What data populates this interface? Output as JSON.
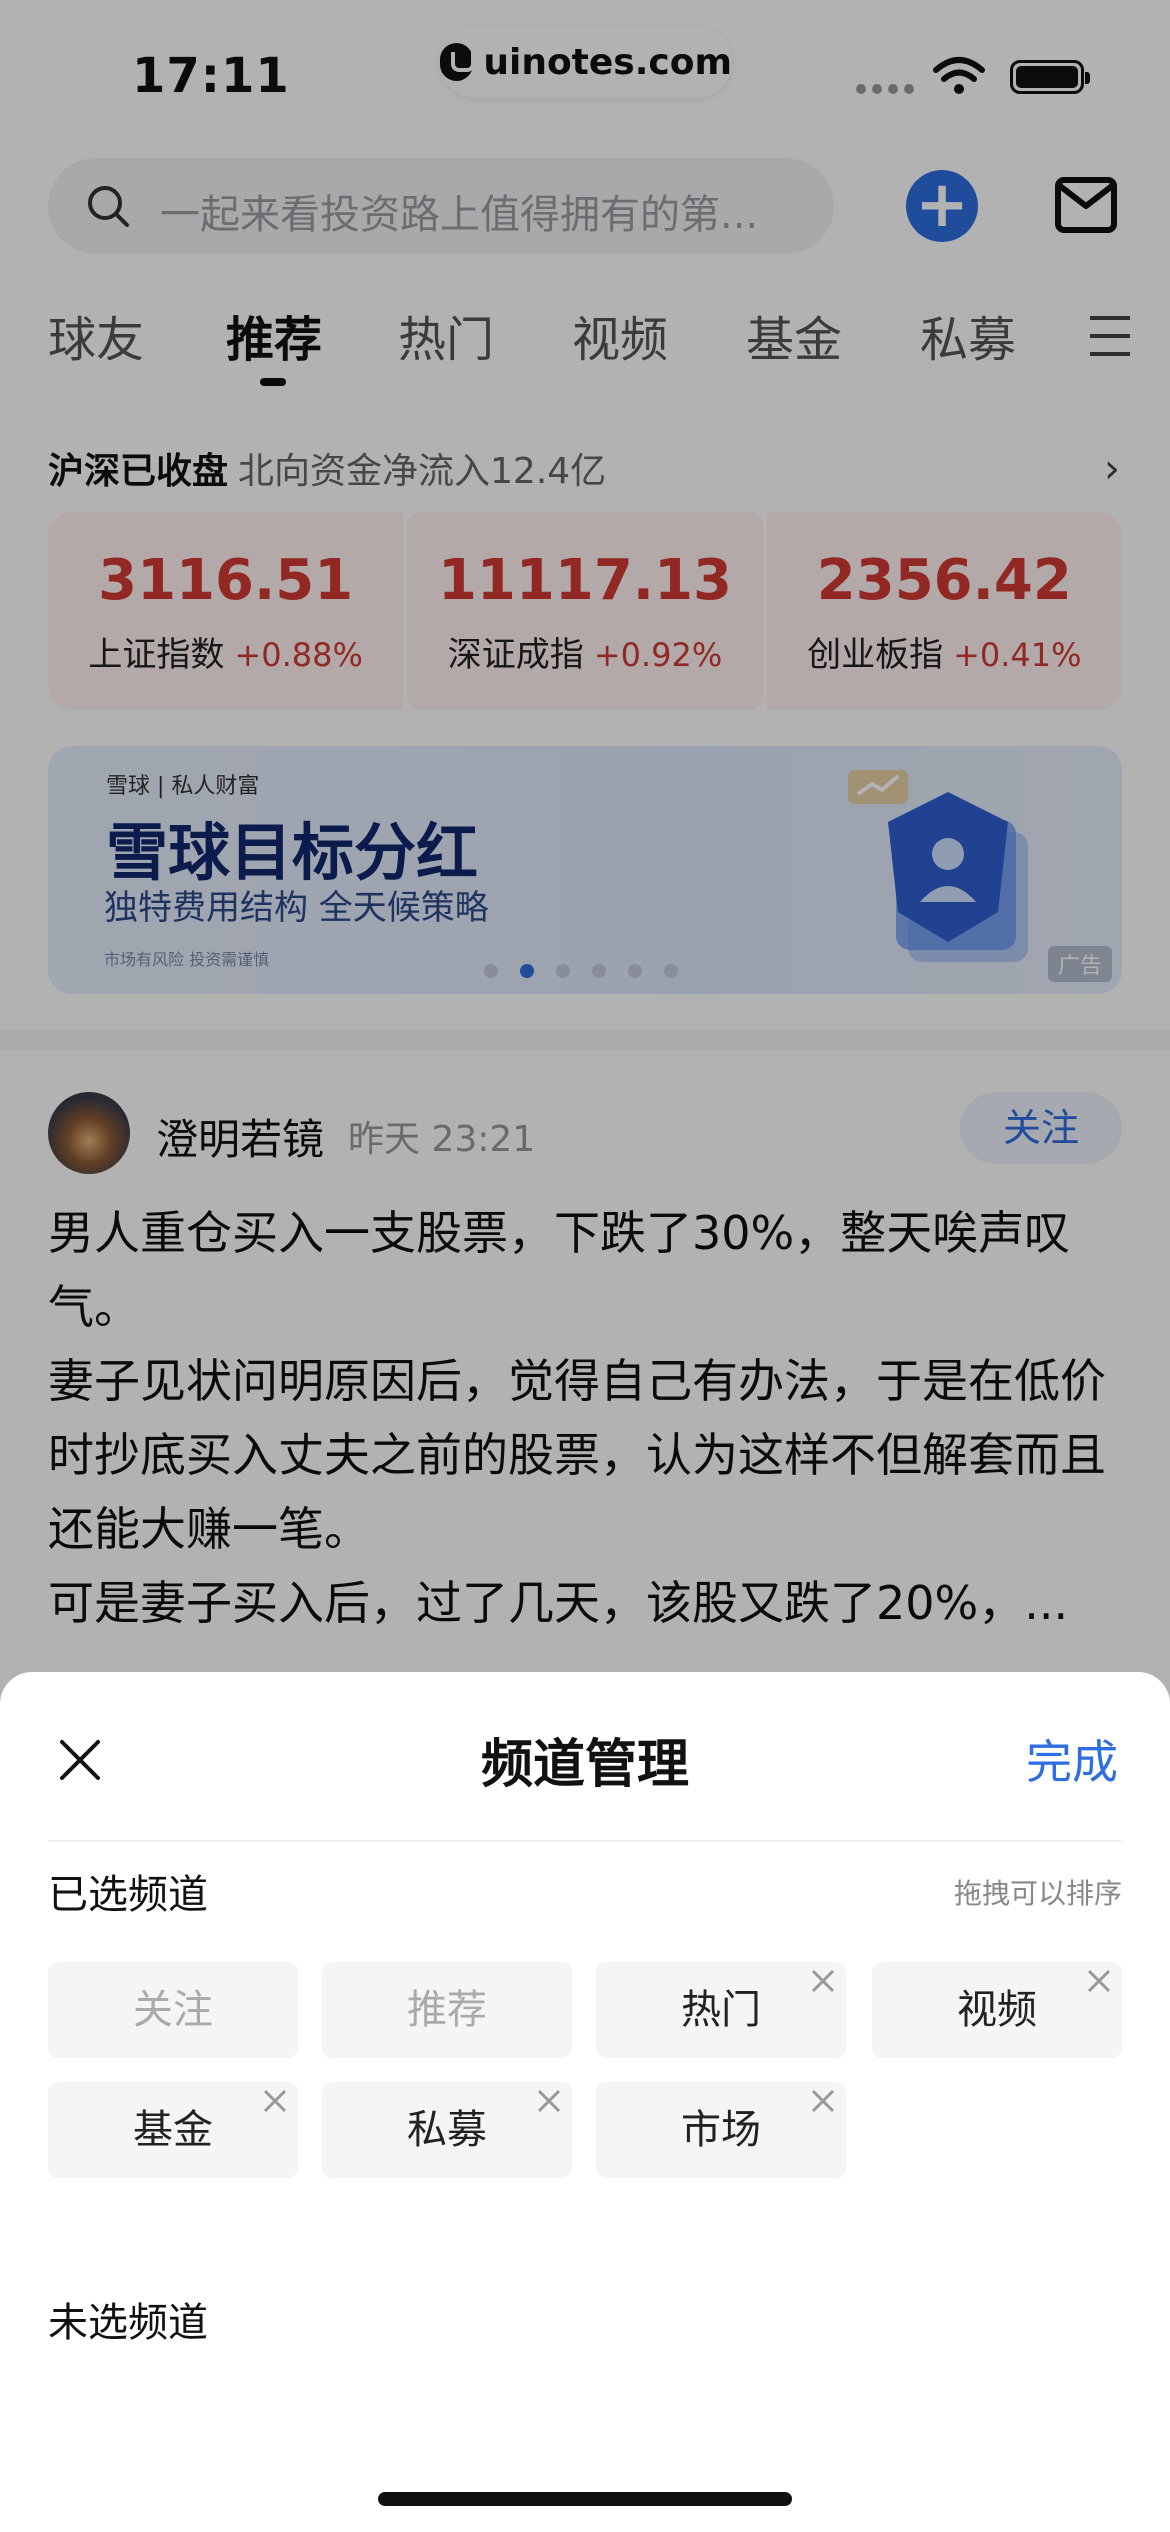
{
  "status_bar": {
    "time": "17:11",
    "url": "uinotes.com"
  },
  "search": {
    "placeholder": "一起来看投资路上值得拥有的第..."
  },
  "tabs": [
    "球友",
    "推荐",
    "热门",
    "视频",
    "基金",
    "私募"
  ],
  "active_tab": "推荐",
  "market": {
    "status": "沪深已收盘",
    "north_flow": "北向资金净流入12.4亿",
    "indices": [
      {
        "value": "3116.51",
        "name": "上证指数",
        "change": "+0.88%"
      },
      {
        "value": "11117.13",
        "name": "深证成指",
        "change": "+0.92%"
      },
      {
        "value": "2356.42",
        "name": "创业板指",
        "change": "+0.41%"
      }
    ]
  },
  "banner": {
    "brand": "雪球 | 私人财富",
    "title": "雪球目标分红",
    "subtitle": "独特费用结构 全天候策略",
    "risk_note": "市场有风险 投资需谨慎",
    "ad_label": "广告",
    "dot_count": 6,
    "active_dot": 1
  },
  "post": {
    "author": "澄明若镜",
    "time": "昨天 23:21",
    "follow_label": "关注",
    "lines": [
      "男人重仓买入一支股票，下跌了30%，整天唉声叹气。",
      "妻子见状问明原因后，觉得自己有办法，于是在低价时抄底买入丈夫之前的股票，认为这样不但解套而且还能大赚一笔。",
      "可是妻子买入后，过了几天，该股又跌了20%，..."
    ]
  },
  "sheet": {
    "title": "频道管理",
    "done_label": "完成",
    "selected_label": "已选频道",
    "sort_hint": "拖拽可以排序",
    "unselected_label": "未选频道",
    "selected_channels": [
      {
        "label": "关注",
        "removable": false
      },
      {
        "label": "推荐",
        "removable": false
      },
      {
        "label": "热门",
        "removable": true
      },
      {
        "label": "视频",
        "removable": true
      },
      {
        "label": "基金",
        "removable": true
      },
      {
        "label": "私募",
        "removable": true
      },
      {
        "label": "市场",
        "removable": true
      }
    ]
  },
  "colors": {
    "accent": "#2f6ee0",
    "up": "#d13a33",
    "overlay": "rgba(0,0,0,0.30)"
  }
}
